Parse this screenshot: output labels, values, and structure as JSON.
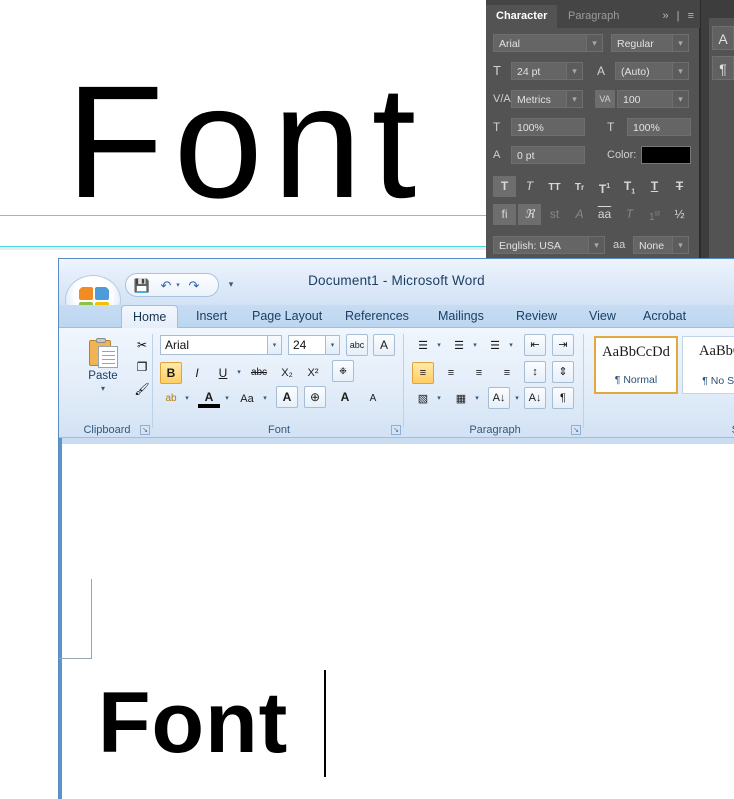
{
  "photoshop": {
    "canvas_text": "Font",
    "panel": {
      "tabs": [
        {
          "label": "Character",
          "active": true
        },
        {
          "label": "Paragraph",
          "active": false
        }
      ],
      "tab_icons": {
        "collapse": "»",
        "divider": "|",
        "menu": "≡"
      },
      "font_family": "Arial",
      "font_style": "Regular",
      "font_size_icon": "T",
      "font_size": "24 pt",
      "leading_icon": "A",
      "leading": "(Auto)",
      "kerning_icon": "V/A",
      "kerning": "Metrics",
      "tracking_icon": "VA",
      "tracking": "100",
      "vertical_scale_icon": "T",
      "vertical_scale": "100%",
      "horizontal_scale_icon": "T",
      "horizontal_scale": "100%",
      "baseline_icon": "A",
      "baseline_shift": "0 pt",
      "color_label": "Color:",
      "color_value": "#000000",
      "style_buttons": [
        {
          "glyph": "T",
          "name": "faux-bold",
          "active": true,
          "dim": false
        },
        {
          "glyph": "T",
          "name": "faux-italic",
          "active": false,
          "dim": false
        },
        {
          "glyph": "TT",
          "name": "all-caps",
          "active": false,
          "dim": false
        },
        {
          "glyph": "Tr",
          "name": "small-caps",
          "active": false,
          "dim": false
        },
        {
          "glyph": "T",
          "name": "superscript",
          "active": false,
          "dim": false
        },
        {
          "glyph": "T",
          "name": "subscript",
          "active": false,
          "dim": false
        },
        {
          "glyph": "T",
          "name": "underline",
          "active": false,
          "dim": false
        },
        {
          "glyph": "T",
          "name": "strikethrough",
          "active": false,
          "dim": false
        }
      ],
      "opentype_buttons": [
        {
          "glyph": "fi",
          "name": "standard-ligatures",
          "active": true,
          "dim": false
        },
        {
          "glyph": "℘",
          "name": "contextual-alternates",
          "active": true,
          "dim": false
        },
        {
          "glyph": "st",
          "name": "discretionary-ligatures",
          "active": false,
          "dim": true
        },
        {
          "glyph": "A",
          "name": "swash",
          "active": false,
          "dim": true
        },
        {
          "glyph": "aa",
          "name": "oldstyle",
          "active": false,
          "dim": false
        },
        {
          "glyph": "T",
          "name": "titling-alternates",
          "active": false,
          "dim": true
        },
        {
          "glyph": "1st",
          "name": "ordinals",
          "active": false,
          "dim": true
        },
        {
          "glyph": "½",
          "name": "fractions",
          "active": false,
          "dim": false
        }
      ],
      "language": "English: USA",
      "antialias_icon": "aa",
      "antialias": "None"
    },
    "dock_buttons": [
      {
        "glyph": "A",
        "name": "character-panel-icon"
      },
      {
        "glyph": "¶",
        "name": "paragraph-panel-icon"
      }
    ]
  },
  "word": {
    "title": "Document1 - Microsoft Word",
    "quick_access": {
      "save": "💾",
      "undo": "↶",
      "undo_caret": "▾",
      "redo": "↷",
      "customize": "▾"
    },
    "tabs": [
      {
        "label": "Home",
        "active": true
      },
      {
        "label": "Insert",
        "active": false
      },
      {
        "label": "Page Layout",
        "active": false
      },
      {
        "label": "References",
        "active": false
      },
      {
        "label": "Mailings",
        "active": false
      },
      {
        "label": "Review",
        "active": false
      },
      {
        "label": "View",
        "active": false
      },
      {
        "label": "Acrobat",
        "active": false
      }
    ],
    "ribbon": {
      "clipboard": {
        "label": "Clipboard",
        "paste_label": "Paste",
        "paste_arrow": "▾",
        "cut_icon": "✂",
        "copy_icon": "❐",
        "format_painter_icon": "🖌",
        "dialog_launcher": "↘"
      },
      "font": {
        "label": "Font",
        "font_name": "Arial",
        "font_size": "24",
        "grow_font": "A",
        "shrink_font": "A",
        "change_case": "Aa",
        "clear_formatting": "A",
        "phonetic_guide": "abc",
        "enclose_characters": "A",
        "bold": "B",
        "bold_active": true,
        "italic": "I",
        "underline": "U",
        "strikethrough": "abc",
        "subscript": "X₂",
        "superscript": "X²",
        "text_highlight": "ab",
        "font_color": "A",
        "text_effects": "A",
        "character_border": "⊕",
        "dialog_launcher": "↘"
      },
      "paragraph": {
        "label": "Paragraph",
        "bullets": "☰",
        "numbering": "☰",
        "multilevel": "☰",
        "decrease_indent": "⇤",
        "increase_indent": "⇥",
        "align_left": "≡",
        "align_left_active": true,
        "align_center": "≡",
        "align_right": "≡",
        "justify": "≡",
        "line_spacing": "↕",
        "shading": "▧",
        "borders": "▦",
        "sort": "A↓",
        "show_marks": "¶",
        "dialog_launcher": "↘"
      },
      "styles": {
        "label": "St",
        "items": [
          {
            "sample": "AaBbCcDd",
            "name": "¶ Normal",
            "selected": true
          },
          {
            "sample": "AaBbCc",
            "name": "¶ No Spa",
            "selected": false
          }
        ]
      }
    },
    "document": {
      "text": "Font"
    }
  }
}
